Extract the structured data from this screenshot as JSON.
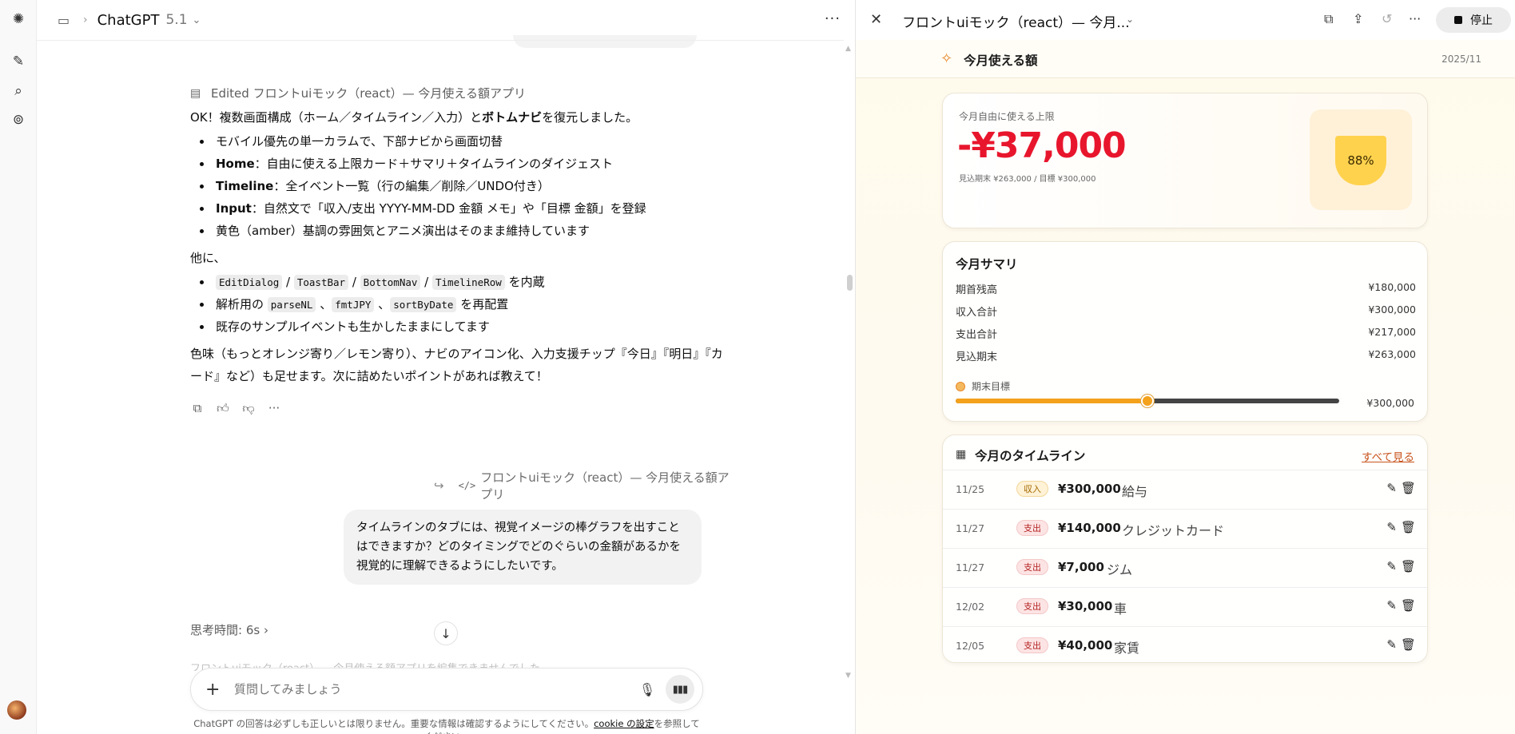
{
  "app": {
    "title": "ChatGPT",
    "version": "5.1"
  },
  "rail": {
    "icons": [
      "openai-logo-icon",
      "new-chat-icon",
      "search-icon",
      "library-icon"
    ]
  },
  "message": {
    "edited_label": "Edited フロントuiモック（react）— 今月使える額アプリ",
    "intro_pre": "OK！複数画面構成（ホーム／タイムライン／入力）と",
    "intro_bold": "ボトムナビ",
    "intro_post": "を復元しました。",
    "bullets": [
      {
        "bold": "",
        "text": "モバイル優先の単一カラムで、下部ナビから画面切替"
      },
      {
        "bold": "Home",
        "text": "：自由に使える上限カード＋サマリ＋タイムラインのダイジェスト"
      },
      {
        "bold": "Timeline",
        "text": "：全イベント一覧（行の編集／削除／UNDO付き）"
      },
      {
        "bold": "Input",
        "text": "：自然文で「収入/支出 YYYY-MM-DD 金額 メモ」や「目標 金額」を登録"
      },
      {
        "bold": "",
        "text": "黄色（amber）基調の雰囲気とアニメ演出はそのまま維持しています"
      }
    ],
    "also": "他に、",
    "bullets2": {
      "components": [
        "EditDialog",
        "ToastBar",
        "BottomNav",
        "TimelineRow"
      ],
      "components_sep": " / ",
      "components_suffix": " を内蔵",
      "parser_prefix": "解析用の ",
      "parsers": [
        "parseNL",
        "fmtJPY",
        "sortByDate"
      ],
      "parser_sep": " 、",
      "parser_suffix": " を再配置",
      "sample": "既存のサンプルイベントも生かしたままにしてます"
    },
    "outro": "色味（もっとオレンジ寄り／レモン寄り）、ナビのアイコン化、入力支援チップ『今日』『明日』『カード』など）も足せます。次に詰めたいポイントがあれば教えて！"
  },
  "reference": {
    "label": "フロントuiモック（react）— 今月使える額アプリ"
  },
  "user_message": "タイムラインのタブには、視覚イメージの棒グラフを出すことはできますか？どのタイミングでどのぐらいの金額があるかを視覚的に理解できるようにしたいです。",
  "thinking": {
    "label": "思考時間: 6s"
  },
  "faded_line": "フロントuiモック（react）— 今月使える額アプリを編集できませんでした",
  "composer": {
    "placeholder": "質問してみましょう"
  },
  "disclaimer": {
    "pre": "ChatGPT の回答は必ずしも正しいとは限りません。重要な情報は確認するようにしてください。",
    "link": "cookie の設定",
    "post": "を参照してください。"
  },
  "doc_panel": {
    "title": "フロントuiモック（react）— 今月...",
    "stop_label": "停止"
  },
  "preview": {
    "header_title": "今月使える額",
    "month": "2025/11",
    "limit_card": {
      "label": "今月自由に使える上限",
      "amount": "-¥37,000",
      "sub": "見込期末 ¥263,000 / 目標 ¥300,000",
      "gauge_text": "88%",
      "gauge_percent": 88
    },
    "summary": {
      "title": "今月サマリ",
      "rows": [
        {
          "label": "期首残高",
          "value": "¥180,000"
        },
        {
          "label": "収入合計",
          "value": "¥300,000"
        },
        {
          "label": "支出合計",
          "value": "¥217,000"
        },
        {
          "label": "見込期末",
          "value": "¥263,000"
        }
      ],
      "goal_label": "期末目標",
      "goal_value": "¥300,000",
      "goal_slider_fraction": 0.5
    },
    "timeline": {
      "title": "今月のタイムライン",
      "see_all": "すべて見る",
      "rows": [
        {
          "date": "11/25",
          "type": "収入",
          "kind": "in",
          "amount": "¥300,000",
          "memo": "給与"
        },
        {
          "date": "11/27",
          "type": "支出",
          "kind": "out",
          "amount": "¥140,000",
          "memo": "クレジットカード"
        },
        {
          "date": "11/27",
          "type": "支出",
          "kind": "out",
          "amount": "¥7,000",
          "memo": "ジム"
        },
        {
          "date": "12/02",
          "type": "支出",
          "kind": "out",
          "amount": "¥30,000",
          "memo": "車"
        },
        {
          "date": "12/05",
          "type": "支出",
          "kind": "out",
          "amount": "¥40,000",
          "memo": "家賃"
        }
      ]
    }
  }
}
